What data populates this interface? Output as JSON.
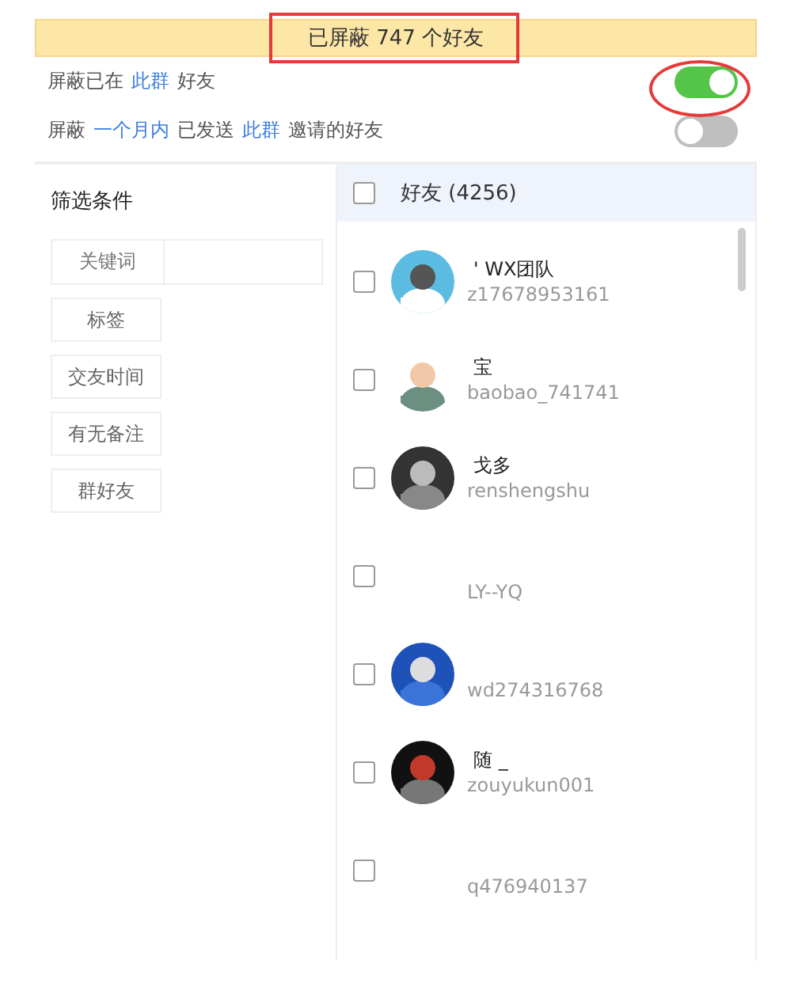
{
  "banner": {
    "text": "已屏蔽 747 个好友"
  },
  "settings": [
    {
      "parts": [
        {
          "text": "屏蔽已在",
          "link": false
        },
        {
          "text": "此群",
          "link": true
        },
        {
          "text": "好友",
          "link": false
        }
      ],
      "on": true
    },
    {
      "parts": [
        {
          "text": "屏蔽",
          "link": false
        },
        {
          "text": "一个月内",
          "link": true
        },
        {
          "text": "已发送",
          "link": false
        },
        {
          "text": "此群",
          "link": true
        },
        {
          "text": "邀请的好友",
          "link": false
        }
      ],
      "on": false
    }
  ],
  "filter": {
    "title": "筛选条件",
    "keyword_label": "关键词",
    "buttons": [
      "标签",
      "交友时间",
      "有无备注",
      "群好友"
    ]
  },
  "friends": {
    "header": "好友 (4256)",
    "checked": false,
    "rows": [
      {
        "name": "' WX团队",
        "id": "z17678953161",
        "avatar": true,
        "checked": false
      },
      {
        "name": "宝",
        "id": "baobao_741741",
        "avatar": true,
        "checked": false
      },
      {
        "name": "戈多",
        "id": "renshengshu",
        "avatar": true,
        "checked": false
      },
      {
        "id": "LY--YQ",
        "avatar": false,
        "checked": false
      },
      {
        "id": "wd274316768",
        "avatar": true,
        "checked": false
      },
      {
        "name": "随 _",
        "id": "zouyukun001",
        "avatar": true,
        "checked": false
      },
      {
        "id": "q476940137",
        "avatar": false,
        "checked": false
      }
    ]
  }
}
